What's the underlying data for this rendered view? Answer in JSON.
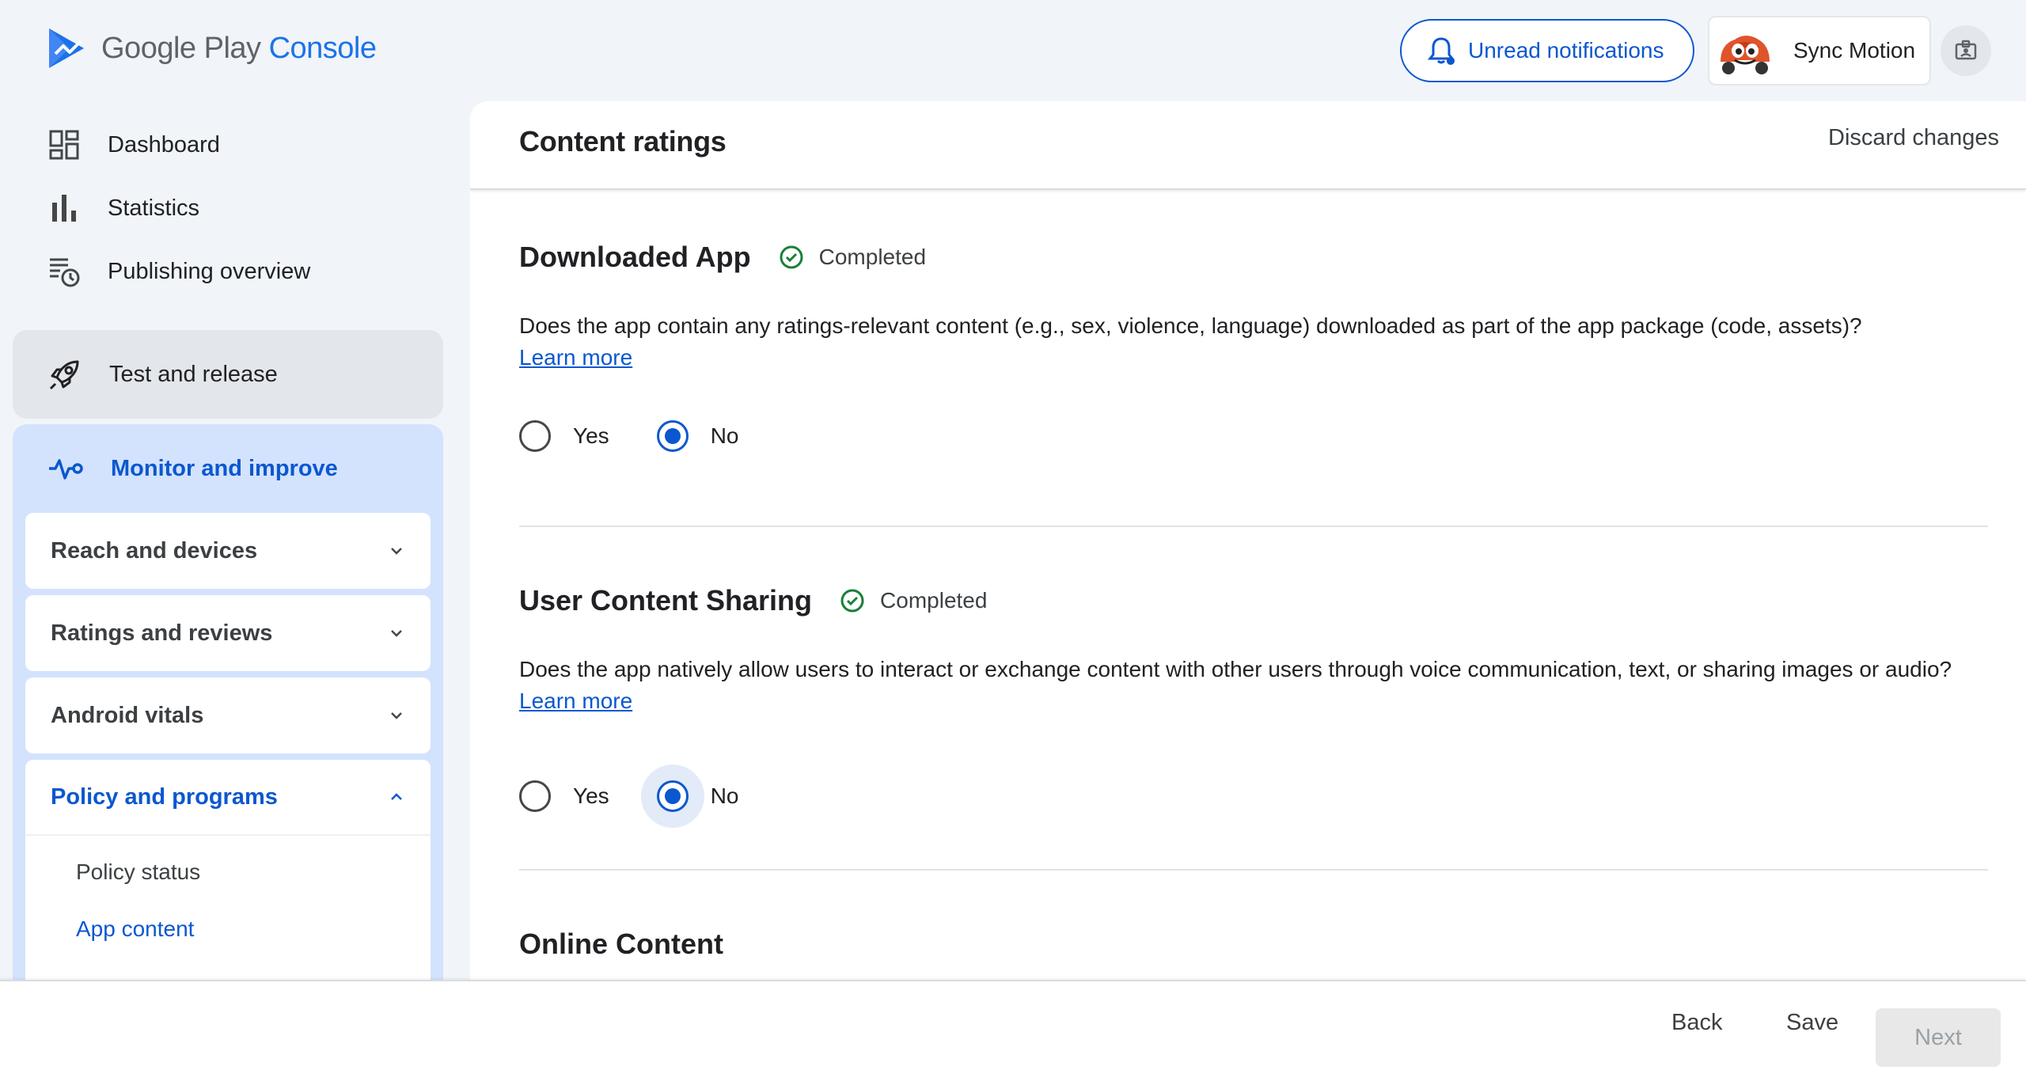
{
  "header": {
    "logo_text_main": "Google Play",
    "logo_text_accent": "Console",
    "notifications_label": "Unread notifications",
    "account_name": "Sync Motion"
  },
  "sidebar": {
    "items": [
      {
        "label": "Dashboard",
        "icon": "dashboard-icon"
      },
      {
        "label": "Statistics",
        "icon": "bar-chart-icon"
      },
      {
        "label": "Publishing overview",
        "icon": "publishing-overview-icon"
      }
    ],
    "test_release": "Test and release",
    "monitor": "Monitor and improve",
    "subsections": [
      "Reach and devices",
      "Ratings and reviews",
      "Android vitals"
    ],
    "policy": {
      "label": "Policy and programs",
      "links": [
        "Policy status",
        "App content"
      ]
    }
  },
  "main": {
    "title": "Content ratings",
    "discard": "Discard changes",
    "sections": [
      {
        "title": "Downloaded App",
        "status": "Completed",
        "question": "Does the app contain any ratings-relevant content (e.g., sex, violence, language) downloaded as part of the app package (code, assets)?",
        "learn_more": "Learn more",
        "yes": "Yes",
        "no": "No",
        "selected": "No"
      },
      {
        "title": "User Content Sharing",
        "status": "Completed",
        "question": "Does the app natively allow users to interact or exchange content with other users through voice communication, text, or sharing images or audio?",
        "learn_more": "Learn more",
        "yes": "Yes",
        "no": "No",
        "selected": "No"
      },
      {
        "title": "Online Content"
      }
    ]
  },
  "footer": {
    "back": "Back",
    "save": "Save",
    "next": "Next"
  },
  "colors": {
    "accent": "#0b57d0",
    "success": "#188038",
    "sidebar_active_bg": "#d3e3fd"
  }
}
